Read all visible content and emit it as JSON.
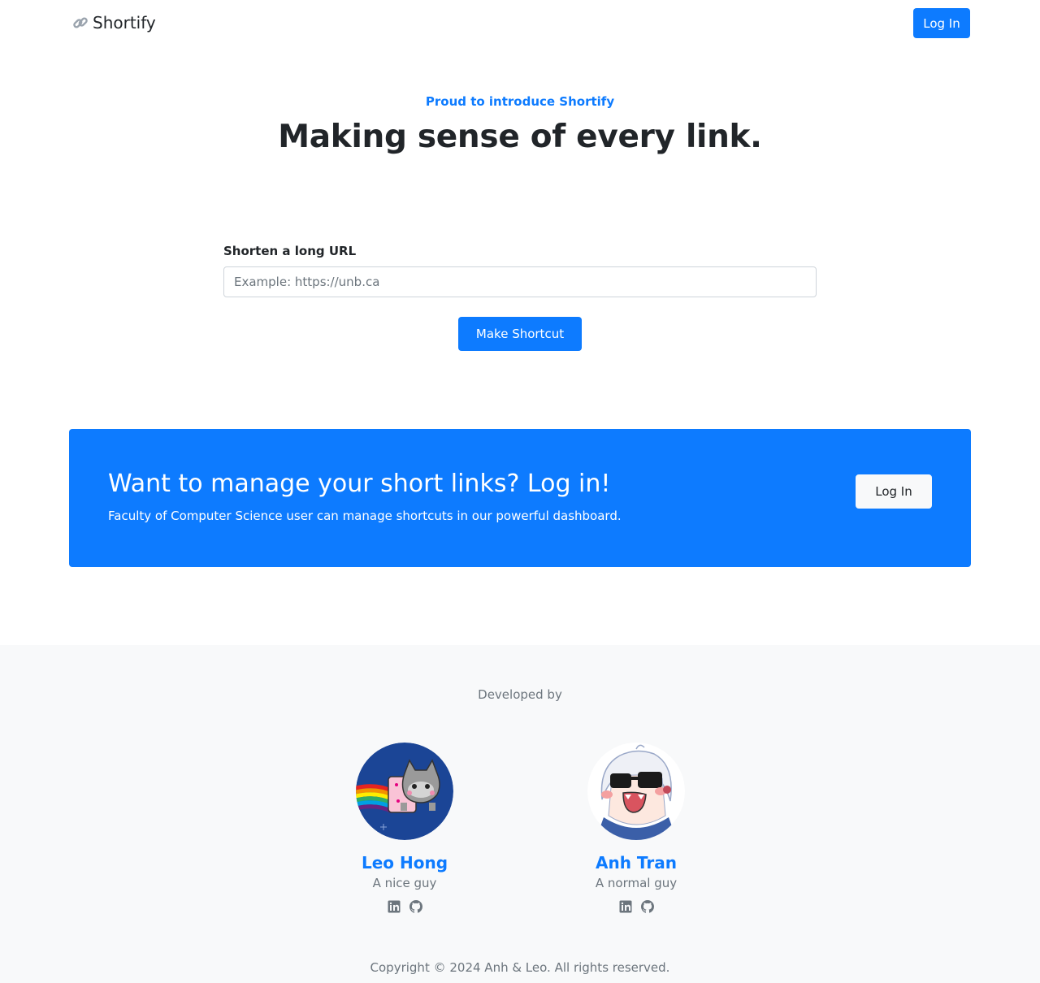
{
  "navbar": {
    "brand": "Shortify",
    "login_label": "Log In"
  },
  "hero": {
    "eyebrow": "Proud to introduce Shortify",
    "title": "Making sense of every link."
  },
  "shorten_form": {
    "label": "Shorten a long URL",
    "value": "",
    "placeholder": "Example: https://unb.ca",
    "submit_label": "Make Shortcut"
  },
  "cta": {
    "title": "Want to manage your short links? Log in!",
    "subtitle": "Faculty of Computer Science user can manage shortcuts in our powerful dashboard.",
    "login_label": "Log In"
  },
  "footer": {
    "developed_by": "Developed by",
    "developers": [
      {
        "name": "Leo Hong",
        "role": "A nice guy",
        "socials": [
          "linkedin-icon",
          "github-icon"
        ]
      },
      {
        "name": "Anh Tran",
        "role": "A normal guy",
        "socials": [
          "linkedin-icon",
          "github-icon"
        ]
      }
    ],
    "copyright": "Copyright © 2024 Anh & Leo. All rights reserved."
  },
  "colors": {
    "primary": "#0d7bff",
    "footer_bg": "#f8f9fa",
    "muted": "#6c757d"
  }
}
